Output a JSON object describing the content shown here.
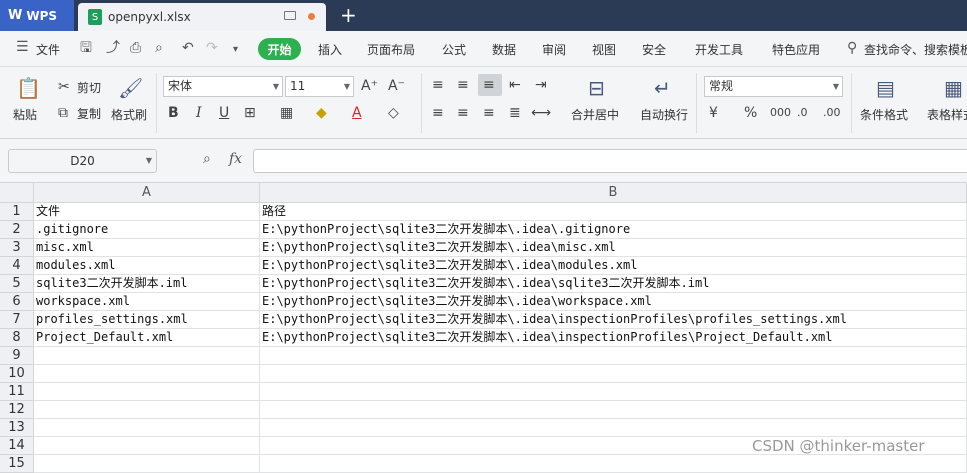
{
  "titlebar": {
    "app_tab": "WPS",
    "file_tab": "openpyxl.xlsx",
    "new_tab": "+"
  },
  "menubar": {
    "file": "文件",
    "active_tab": "开始",
    "tabs": [
      "插入",
      "页面布局",
      "公式",
      "数据",
      "审阅",
      "视图",
      "安全",
      "开发工具",
      "特色应用"
    ],
    "search": "查找命令、搜索模板"
  },
  "ribbon": {
    "paste": "粘贴",
    "cut": "剪切",
    "copy": "复制",
    "format_painter": "格式刷",
    "font_name": "宋体",
    "font_size": "11",
    "bold": "B",
    "italic": "I",
    "underline": "U",
    "merge_center": "合并居中",
    "wrap_text": "自动换行",
    "number_format": "常规",
    "conditional_format": "条件格式",
    "table_style": "表格样式"
  },
  "formula_bar": {
    "name_box": "D20",
    "fx": "fx"
  },
  "sheet": {
    "columns": [
      "A",
      "B"
    ],
    "rows": [
      {
        "num": "1",
        "a": "文件",
        "b": "路径"
      },
      {
        "num": "2",
        "a": ".gitignore",
        "b": "E:\\pythonProject\\sqlite3二次开发脚本\\.idea\\.gitignore"
      },
      {
        "num": "3",
        "a": "misc.xml",
        "b": "E:\\pythonProject\\sqlite3二次开发脚本\\.idea\\misc.xml"
      },
      {
        "num": "4",
        "a": "modules.xml",
        "b": "E:\\pythonProject\\sqlite3二次开发脚本\\.idea\\modules.xml"
      },
      {
        "num": "5",
        "a": "sqlite3二次开发脚本.iml",
        "b": "E:\\pythonProject\\sqlite3二次开发脚本\\.idea\\sqlite3二次开发脚本.iml"
      },
      {
        "num": "6",
        "a": "workspace.xml",
        "b": "E:\\pythonProject\\sqlite3二次开发脚本\\.idea\\workspace.xml"
      },
      {
        "num": "7",
        "a": "profiles_settings.xml",
        "b": "E:\\pythonProject\\sqlite3二次开发脚本\\.idea\\inspectionProfiles\\profiles_settings.xml"
      },
      {
        "num": "8",
        "a": "Project_Default.xml",
        "b": "E:\\pythonProject\\sqlite3二次开发脚本\\.idea\\inspectionProfiles\\Project_Default.xml"
      },
      {
        "num": "9",
        "a": "",
        "b": ""
      },
      {
        "num": "10",
        "a": "",
        "b": ""
      },
      {
        "num": "11",
        "a": "",
        "b": ""
      },
      {
        "num": "12",
        "a": "",
        "b": ""
      },
      {
        "num": "13",
        "a": "",
        "b": ""
      },
      {
        "num": "14",
        "a": "",
        "b": ""
      },
      {
        "num": "15",
        "a": "",
        "b": ""
      }
    ]
  },
  "watermark": "CSDN @thinker-master"
}
